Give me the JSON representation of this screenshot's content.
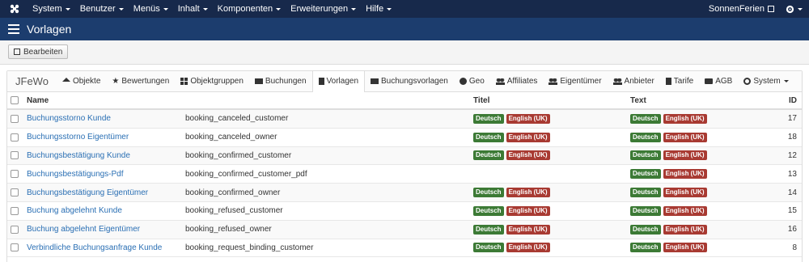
{
  "topbar": {
    "menus": [
      "System",
      "Benutzer",
      "Menüs",
      "Inhalt",
      "Komponenten",
      "Erweiterungen",
      "Hilfe"
    ],
    "site_name": "SonnenFerien"
  },
  "title": "Vorlagen",
  "toolbar": {
    "edit_label": "Bearbeiten"
  },
  "nav": {
    "brand": "JFeWo",
    "items": [
      {
        "label": "Objekte",
        "icon": "home-icon"
      },
      {
        "label": "Bewertungen",
        "icon": "star-icon"
      },
      {
        "label": "Objektgruppen",
        "icon": "grid-icon"
      },
      {
        "label": "Buchungen",
        "icon": "envelope-icon"
      },
      {
        "label": "Vorlagen",
        "icon": "document-icon"
      },
      {
        "label": "Buchungsvorlagen",
        "icon": "envelope-icon"
      },
      {
        "label": "Geo",
        "icon": "globe-icon"
      },
      {
        "label": "Affiliates",
        "icon": "users-icon"
      },
      {
        "label": "Eigentümer",
        "icon": "users-icon"
      },
      {
        "label": "Anbieter",
        "icon": "users-icon"
      },
      {
        "label": "Tarife",
        "icon": "document-icon"
      },
      {
        "label": "AGB",
        "icon": "folder-icon"
      },
      {
        "label": "System",
        "icon": "gear-icon"
      }
    ]
  },
  "table": {
    "headers": {
      "name": "Name",
      "titel": "Titel",
      "text": "Text",
      "id": "ID"
    },
    "badge_de": "Deutsch",
    "badge_en": "English (UK)",
    "rows": [
      {
        "name": "Buchungsstorno Kunde",
        "key": "booking_canceled_customer",
        "id": "17",
        "titel": true,
        "text": true
      },
      {
        "name": "Buchungsstorno Eigentümer",
        "key": "booking_canceled_owner",
        "id": "18",
        "titel": true,
        "text": true
      },
      {
        "name": "Buchungsbestätigung Kunde",
        "key": "booking_confirmed_customer",
        "id": "12",
        "titel": true,
        "text": true
      },
      {
        "name": "Buchungsbestätigungs-Pdf",
        "key": "booking_confirmed_customer_pdf",
        "id": "13",
        "titel": false,
        "text": true
      },
      {
        "name": "Buchungsbestätigung Eigentümer",
        "key": "booking_confirmed_owner",
        "id": "14",
        "titel": true,
        "text": true
      },
      {
        "name": "Buchung abgelehnt Kunde",
        "key": "booking_refused_customer",
        "id": "15",
        "titel": true,
        "text": true
      },
      {
        "name": "Buchung abgelehnt Eigentümer",
        "key": "booking_refused_owner",
        "id": "16",
        "titel": true,
        "text": true
      },
      {
        "name": "Verbindliche Buchungsanfrage Kunde",
        "key": "booking_request_binding_customer",
        "id": "8",
        "titel": true,
        "text": true
      }
    ]
  }
}
